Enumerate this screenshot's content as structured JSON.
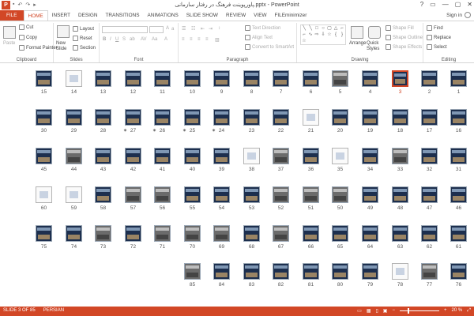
{
  "app": {
    "icon_letter": "P",
    "title": "پاورپوینت فرهنگ در رفتار سازمانی.pptx - PowerPoint",
    "window_controls": [
      "?",
      "▭",
      "—",
      "▢",
      "✕"
    ]
  },
  "tabs": [
    {
      "label": "FILE",
      "kind": "file"
    },
    {
      "label": "HOME",
      "kind": "active"
    },
    {
      "label": "INSERT"
    },
    {
      "label": "DESIGN"
    },
    {
      "label": "TRANSITIONS"
    },
    {
      "label": "ANIMATIONS"
    },
    {
      "label": "SLIDE SHOW"
    },
    {
      "label": "REVIEW"
    },
    {
      "label": "VIEW"
    },
    {
      "label": "FILEminimizer"
    }
  ],
  "signin": "Sign in",
  "ribbon": {
    "clipboard": {
      "label": "Clipboard",
      "paste": "Paste",
      "cut": "Cut",
      "copy": "Copy",
      "format_painter": "Format Painter"
    },
    "slides": {
      "label": "Slides",
      "new_slide": "New Slide",
      "layout": "Layout",
      "reset": "Reset",
      "section": "Section"
    },
    "font": {
      "label": "Font"
    },
    "paragraph": {
      "label": "Paragraph",
      "text_direction": "Text Direction",
      "align_text": "Align Text",
      "convert_smartart": "Convert to SmartArt"
    },
    "drawing": {
      "label": "Drawing",
      "arrange": "Arrange",
      "quick_styles": "Quick Styles",
      "shape_fill": "Shape Fill",
      "shape_outline": "Shape Outline",
      "shape_effects": "Shape Effects"
    },
    "editing": {
      "label": "Editing",
      "find": "Find",
      "replace": "Replace",
      "select": "Select"
    }
  },
  "slides": {
    "rows": [
      [
        "15",
        "14",
        "13",
        "12",
        "11",
        "10",
        "9",
        "8",
        "7",
        "6",
        "5",
        "4",
        "3",
        "2",
        "1"
      ],
      [
        "30",
        "29",
        "28",
        "27",
        "26",
        "25",
        "24",
        "23",
        "22",
        "21",
        "20",
        "19",
        "18",
        "17",
        "16"
      ],
      [
        "45",
        "44",
        "43",
        "42",
        "41",
        "40",
        "39",
        "38",
        "37",
        "36",
        "35",
        "34",
        "33",
        "32",
        "31"
      ],
      [
        "60",
        "59",
        "58",
        "57",
        "56",
        "55",
        "54",
        "53",
        "52",
        "51",
        "50",
        "49",
        "48",
        "47",
        "46"
      ],
      [
        "75",
        "74",
        "73",
        "72",
        "71",
        "70",
        "69",
        "68",
        "67",
        "66",
        "65",
        "64",
        "63",
        "62",
        "61"
      ],
      [
        "",
        "",
        "",
        "",
        "",
        "85",
        "84",
        "83",
        "82",
        "81",
        "80",
        "79",
        "78",
        "77",
        "76"
      ]
    ],
    "selected": "3",
    "animated": [
      "27",
      "26",
      "25",
      "24"
    ]
  },
  "status": {
    "slide_info": "SLIDE 3 OF 85",
    "language": "PERSIAN",
    "zoom": "20 %"
  },
  "colors": {
    "accent": "#d24726"
  }
}
